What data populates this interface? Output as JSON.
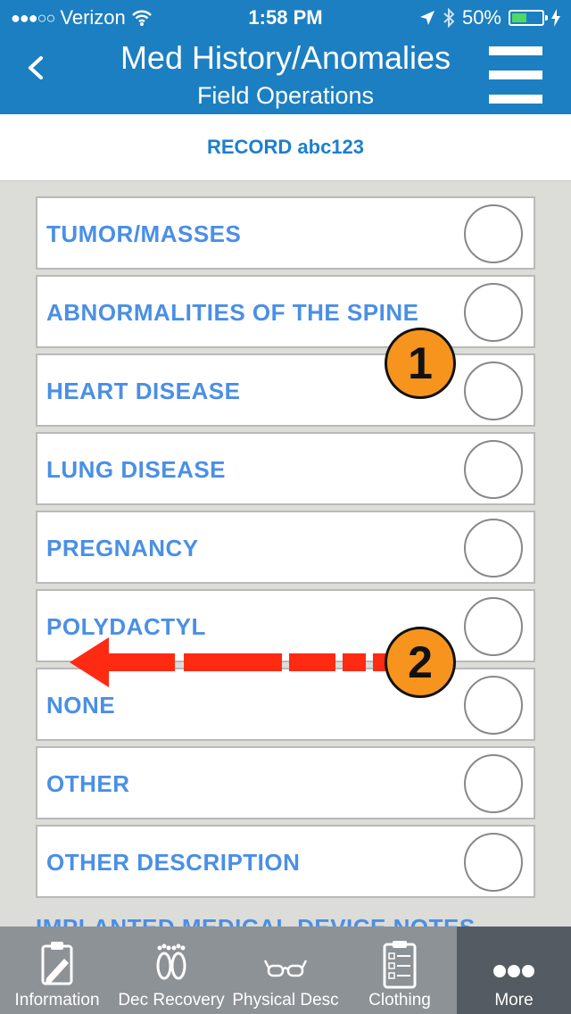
{
  "status_bar": {
    "signal_dots": "●●●○○",
    "carrier": "Verizon",
    "time": "1:58 PM",
    "battery": "50%",
    "battery_level": 0.5
  },
  "nav": {
    "title": "Med History/Anomalies",
    "subtitle": "Field Operations"
  },
  "record_label": "RECORD abc123",
  "options": [
    {
      "label": "TUMOR/MASSES"
    },
    {
      "label": "ABNORMALITIES OF THE SPINE"
    },
    {
      "label": "HEART DISEASE"
    },
    {
      "label": "LUNG DISEASE"
    },
    {
      "label": "PREGNANCY"
    },
    {
      "label": "POLYDACTYL"
    },
    {
      "label": "NONE"
    },
    {
      "label": "OTHER"
    },
    {
      "label": "OTHER DESCRIPTION"
    }
  ],
  "cutoff_text": "IMPLANTED MEDICAL DEVICE NOTES",
  "annotations": {
    "badge1": "1",
    "badge2": "2"
  },
  "tabs": [
    {
      "label": "Information",
      "icon": "clipboard-pencil-icon"
    },
    {
      "label": "Dec Recovery",
      "icon": "feet-icon"
    },
    {
      "label": "Physical Desc",
      "icon": "glasses-icon"
    },
    {
      "label": "Clothing",
      "icon": "checklist-icon"
    },
    {
      "label": "More",
      "icon": "ellipsis-icon"
    }
  ],
  "colors": {
    "header": "#1c7fc1",
    "label": "#4a8fe6",
    "badge": "#f7941d",
    "arrow": "#ff2a12",
    "tab_bar": "#8d9297",
    "tab_active": "#545b63"
  }
}
